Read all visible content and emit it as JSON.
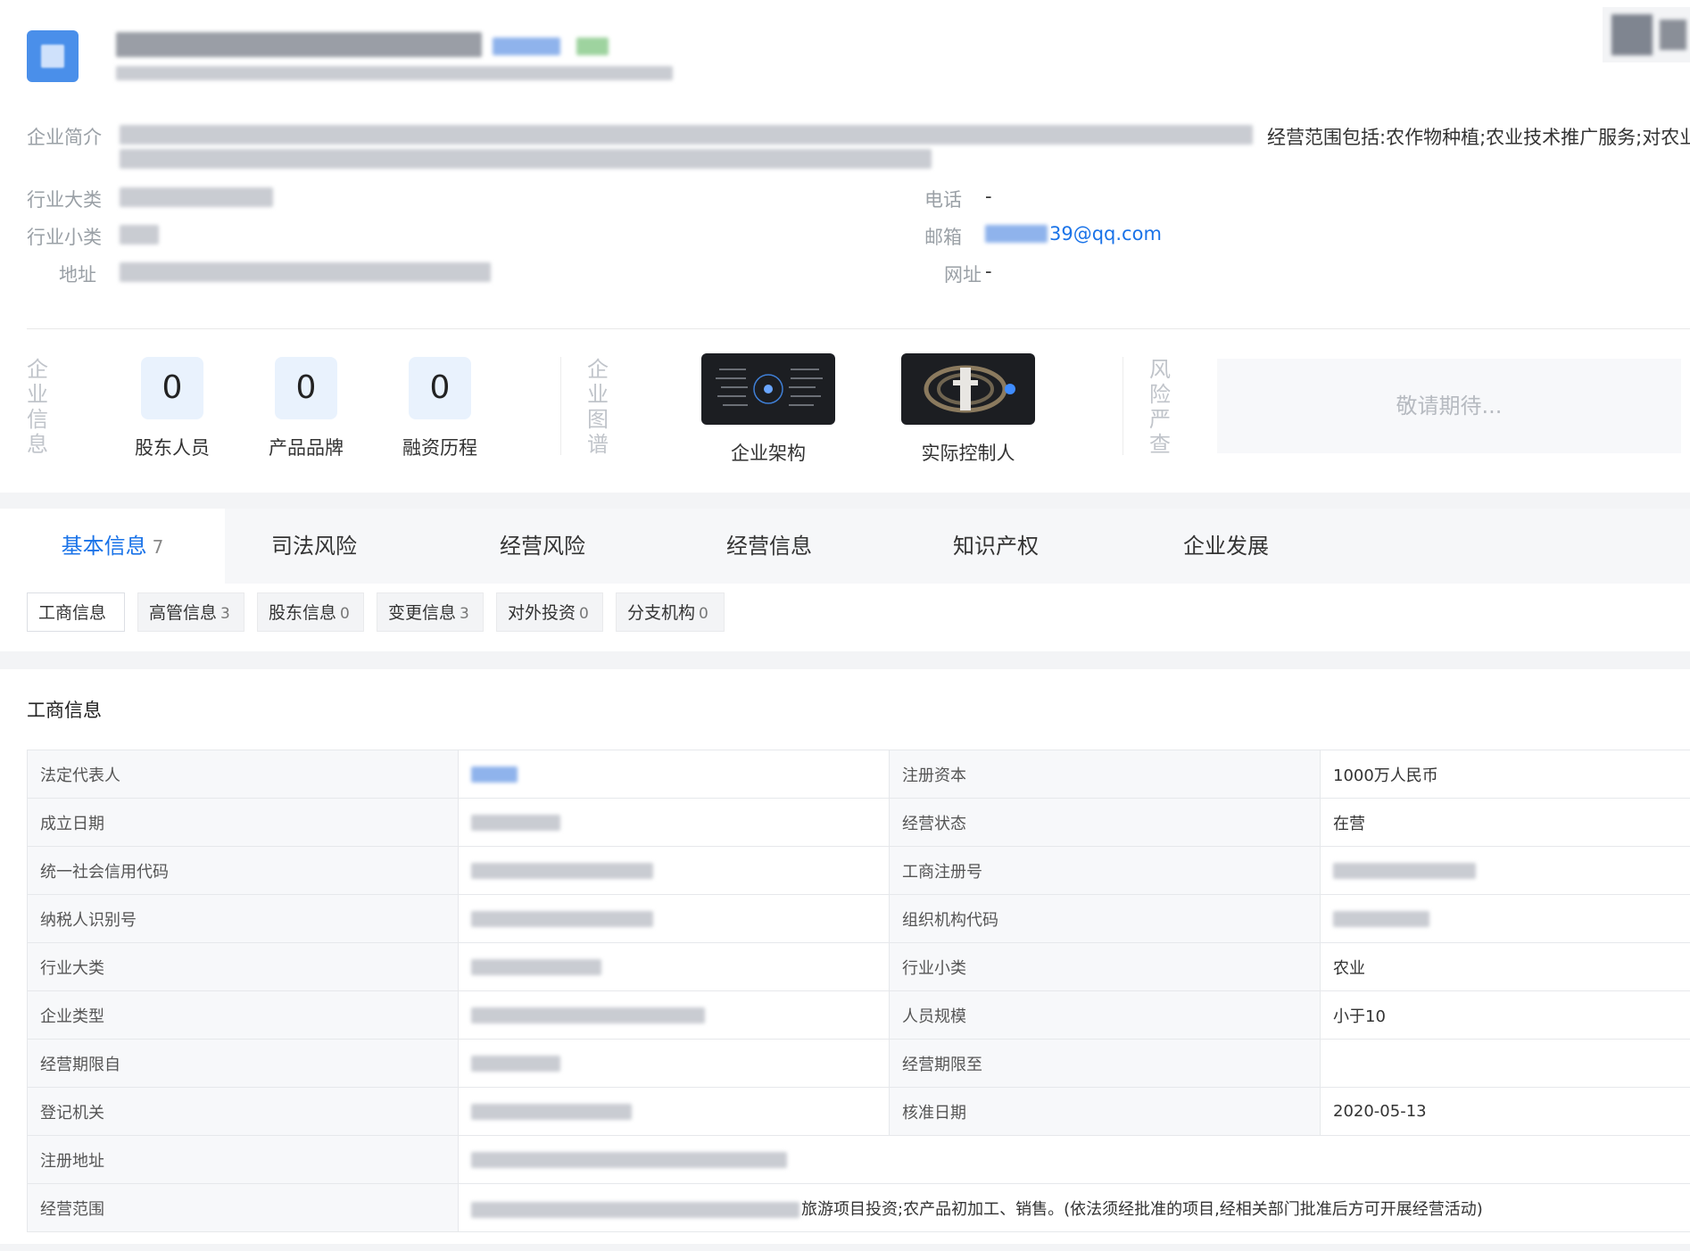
{
  "intro": {
    "label": "企业简介",
    "visible_text": "经营范围包括:农作物种植;农业技术推广服务;对农业"
  },
  "contacts": {
    "industry_label": "行业大类",
    "subindustry_label": "行业小类",
    "address_label": "地址",
    "phone_label": "电话",
    "phone_value": "-",
    "email_label": "邮箱",
    "email_visible": "39@qq.com",
    "web_label": "网址",
    "web_value": "-"
  },
  "strip": {
    "corp_info_vertical": "企业信息",
    "graph_vertical": "企业图谱",
    "risk_vertical": "风险严查",
    "stats": [
      {
        "count": "0",
        "label": "股东人员"
      },
      {
        "count": "0",
        "label": "产品品牌"
      },
      {
        "count": "0",
        "label": "融资历程"
      }
    ],
    "cards": [
      {
        "label": "企业架构",
        "icon": "org-structure-thumbnail"
      },
      {
        "label": "实际控制人",
        "icon": "controller-thumbnail"
      }
    ],
    "coming_soon": "敬请期待..."
  },
  "tabs": [
    {
      "label": "基本信息",
      "badge": "7",
      "active": true
    },
    {
      "label": "司法风险"
    },
    {
      "label": "经营风险"
    },
    {
      "label": "经营信息"
    },
    {
      "label": "知识产权"
    },
    {
      "label": "企业发展"
    }
  ],
  "subtabs": [
    {
      "label": "工商信息",
      "count": ""
    },
    {
      "label": "高管信息",
      "count": "3"
    },
    {
      "label": "股东信息",
      "count": "0"
    },
    {
      "label": "变更信息",
      "count": "3"
    },
    {
      "label": "对外投资",
      "count": "0"
    },
    {
      "label": "分支机构",
      "count": "0"
    }
  ],
  "section_title": "工商信息",
  "table": {
    "rows": [
      {
        "k1": "法定代表人",
        "k2": "注册资本",
        "v2": "1000万人民币"
      },
      {
        "k1": "成立日期",
        "k2": "经营状态",
        "v2": "在营"
      },
      {
        "k1": "统一社会信用代码",
        "k2": "工商注册号",
        "v2": ""
      },
      {
        "k1": "纳税人识别号",
        "k2": "组织机构代码",
        "v2": ""
      },
      {
        "k1": "行业大类",
        "k2": "行业小类",
        "v2": "农业"
      },
      {
        "k1": "企业类型",
        "k2": "人员规模",
        "v2": "小于10"
      },
      {
        "k1": "经营期限自",
        "k2": "经营期限至",
        "v2": ""
      },
      {
        "k1": "登记机关",
        "k2": "核准日期",
        "v2": "2020-05-13"
      }
    ],
    "address_label": "注册地址",
    "scope_label": "经营范围",
    "scope_visible": "旅游项目投资;农产品初加工、销售。(依法须经批准的项目,经相关部门批准后方可开展经营活动)"
  },
  "colors": {
    "accent": "#1a73e8",
    "stat_bg": "#e9f2fd",
    "label_grey": "#9aa0a6"
  }
}
